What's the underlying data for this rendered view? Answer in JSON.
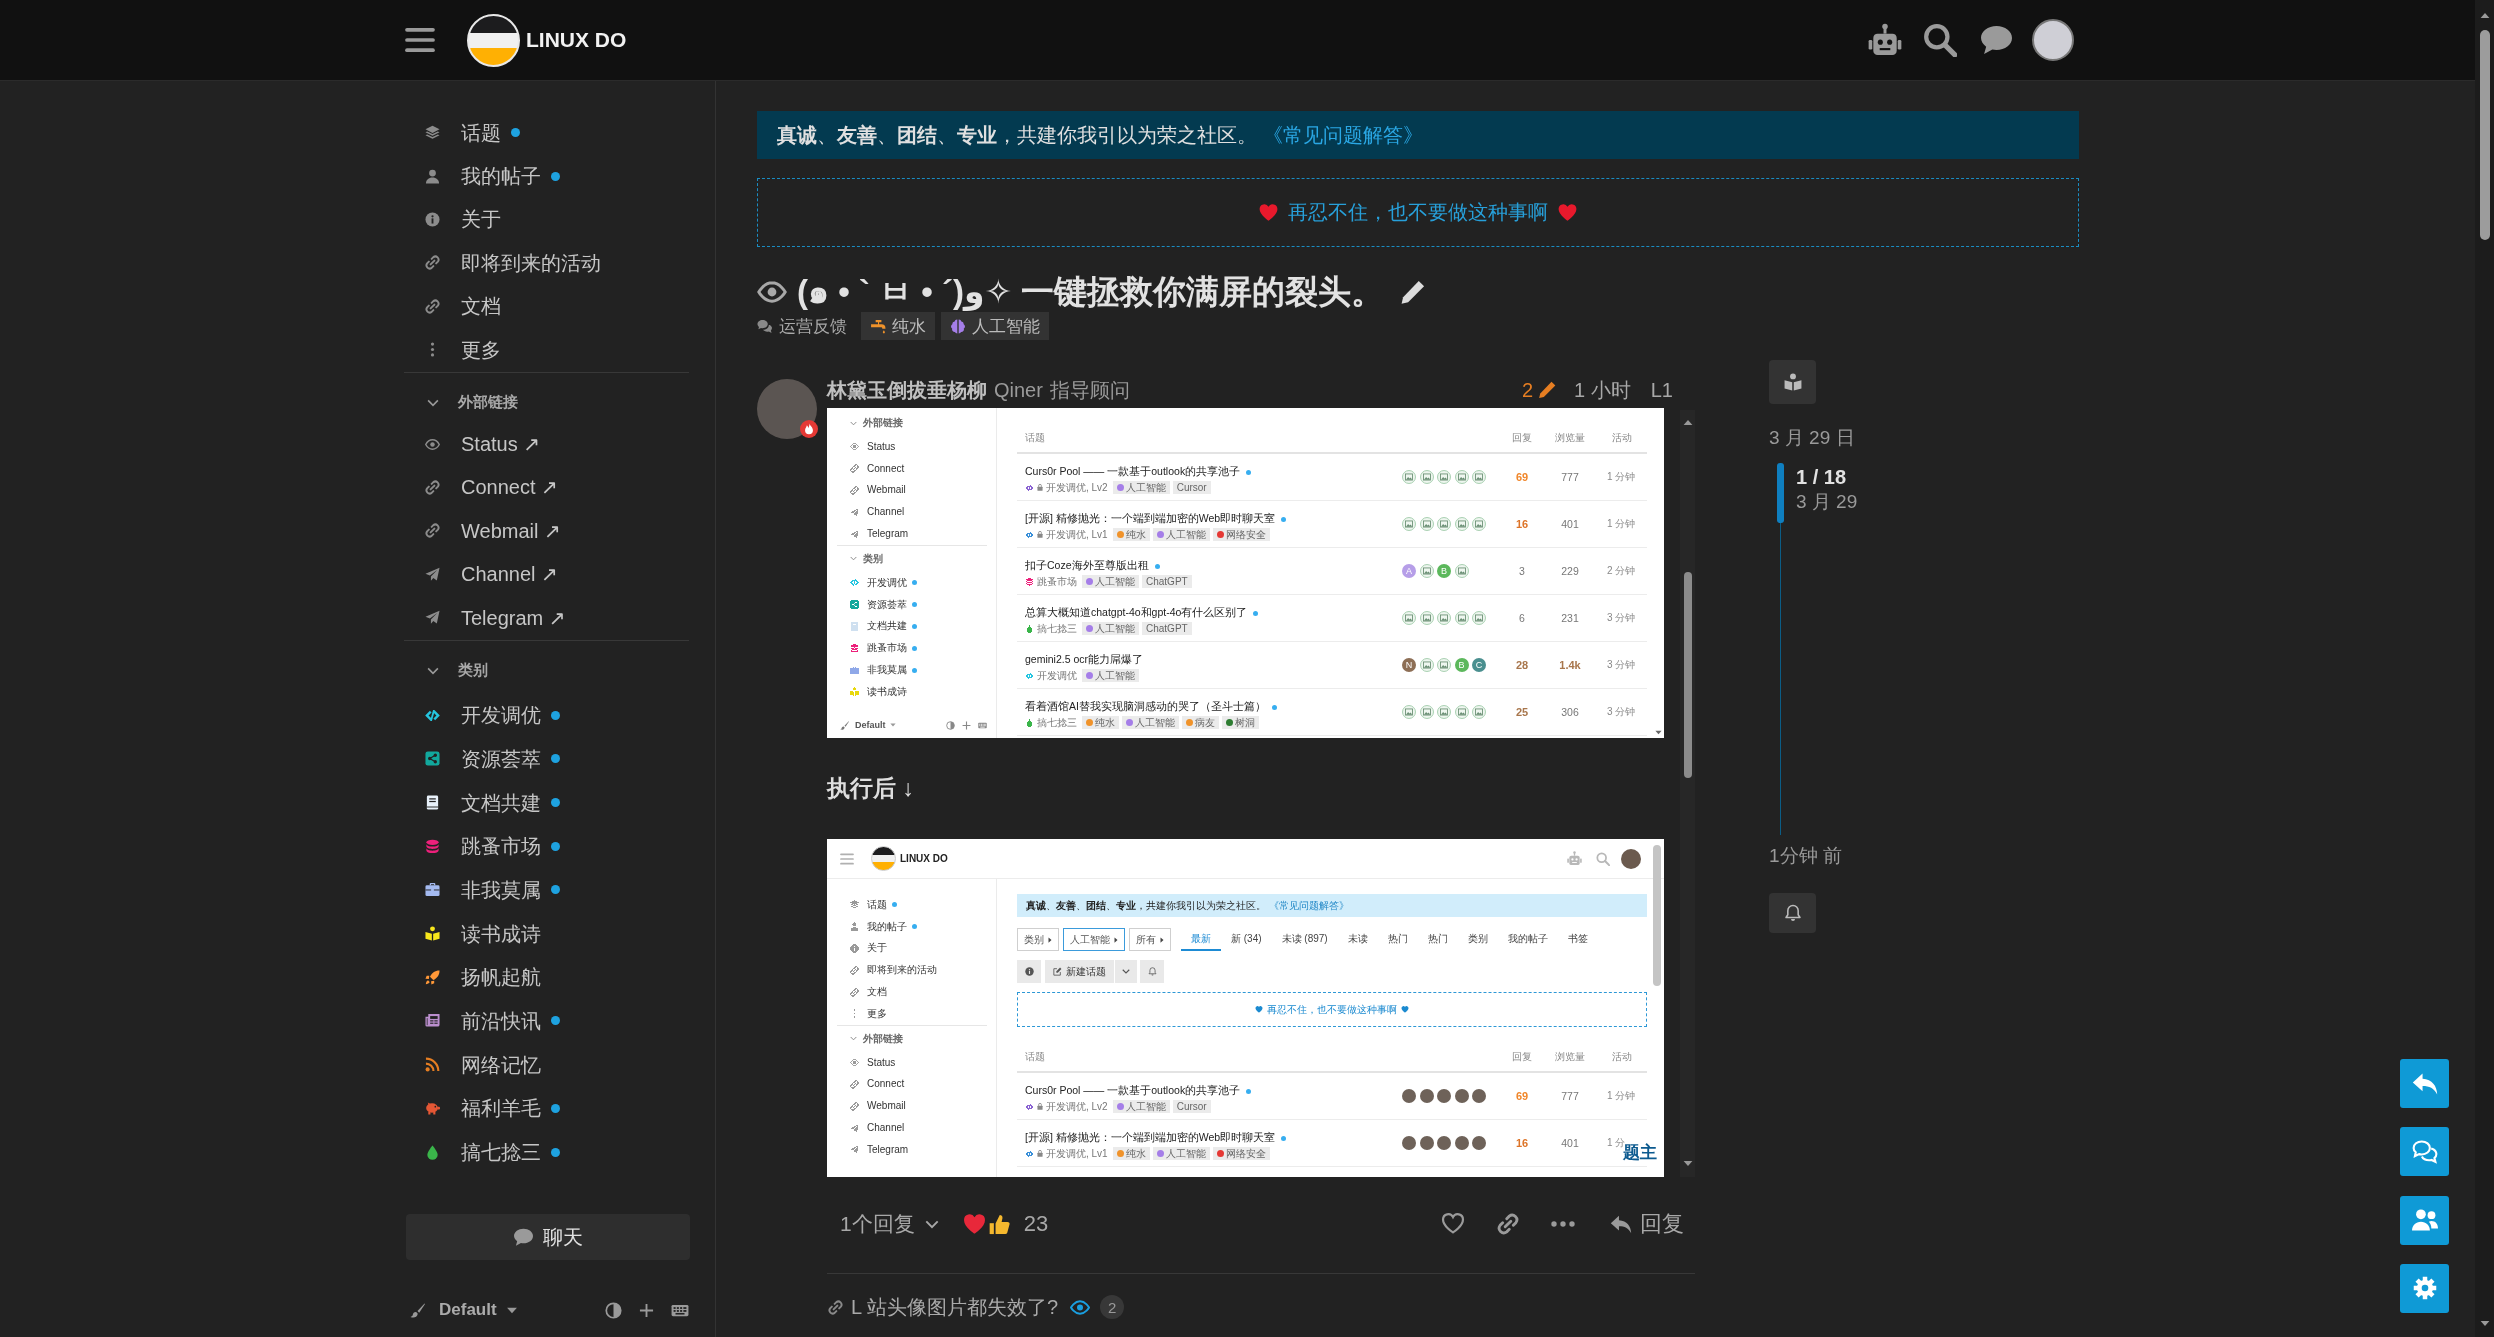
{
  "header": {
    "logo_text": "LINUX DO"
  },
  "sidebar": {
    "items": [
      {
        "label": "话题",
        "unread": true
      },
      {
        "label": "我的帖子",
        "unread": true
      },
      {
        "label": "关于",
        "unread": false
      },
      {
        "label": "即将到来的活动",
        "unread": false
      },
      {
        "label": "文档",
        "unread": false
      },
      {
        "label": "更多",
        "unread": false
      }
    ],
    "sections": [
      {
        "title": "外部链接",
        "expanded": true,
        "items": [
          {
            "label": "Status",
            "arrow": "↗"
          },
          {
            "label": "Connect",
            "arrow": "↗"
          },
          {
            "label": "Webmail",
            "arrow": "↗"
          },
          {
            "label": "Channel",
            "arrow": "↗"
          },
          {
            "label": "Telegram",
            "arrow": "↗"
          }
        ]
      },
      {
        "title": "类别",
        "expanded": true,
        "items": [
          {
            "label": "开发调优",
            "color": "#25c5e0",
            "unread": true
          },
          {
            "label": "资源荟萃",
            "color": "#12a89d",
            "unread": true
          },
          {
            "label": "文档共建",
            "color": "#e8f1fa",
            "unread": true
          },
          {
            "label": "跳蚤市场",
            "color": "#ed207b",
            "unread": true
          },
          {
            "label": "非我莫属",
            "color": "#a4baf0",
            "unread": true
          },
          {
            "label": "读书成诗",
            "color": "#f8e71c",
            "unread": false
          },
          {
            "label": "扬帆起航",
            "color": "#ff9838",
            "unread": false
          },
          {
            "label": "前沿快讯",
            "color": "#bb8fce",
            "unread": true
          },
          {
            "label": "网络记忆",
            "color": "#e67e22",
            "unread": false
          },
          {
            "label": "福利羊毛",
            "color": "#e45735",
            "unread": true
          },
          {
            "label": "搞七捻三",
            "color": "#3ab54a",
            "unread": true
          }
        ]
      }
    ],
    "chat_button": "聊天",
    "footer": {
      "theme": "Default"
    }
  },
  "banner": {
    "text": "**真诚**、**友善**、**团结**、**专业**，共建你我引以为荣之社区。",
    "link": "《常见问题解答》"
  },
  "notice": {
    "text": "再忍不住，也不要做这种事啊"
  },
  "topic": {
    "title": "(๑ • ` ㅂ • ´)و✧ 一键拯救你满屏的裂头。",
    "category": "运营反馈",
    "tags": [
      {
        "label": "纯水",
        "color": "#f0932b"
      },
      {
        "label": "人工智能",
        "color": "#a57ee8"
      }
    ]
  },
  "post": {
    "username": "林黛玉倒拔垂杨柳",
    "name": "Qiner",
    "user_title": "指导顾问",
    "edit_count": "2",
    "age": "1 小时",
    "number": "L1",
    "content": [
      {
        "kind": "screenshot",
        "sidebar": {
          "sections": [
            {
              "title": "外部链接",
              "expanded": true,
              "items": [
                {
                  "label": "Status"
                },
                {
                  "label": "Connect"
                },
                {
                  "label": "Webmail"
                },
                {
                  "label": "Channel"
                },
                {
                  "label": "Telegram"
                }
              ]
            },
            {
              "title": "类别",
              "expanded": true,
              "items": [
                {
                  "label": "开发调优",
                  "color": "#25c5e0",
                  "unread": true
                },
                {
                  "label": "资源荟萃",
                  "color": "#12a89d",
                  "unread": true
                },
                {
                  "label": "文档共建",
                  "color": "#cfe0f0",
                  "unread": true
                },
                {
                  "label": "跳蚤市场",
                  "color": "#ed207b",
                  "unread": true
                },
                {
                  "label": "非我莫属",
                  "color": "#8fa8e8",
                  "unread": true
                },
                {
                  "label": "读书成诗",
                  "color": "#e8d80c",
                  "unread": false
                }
              ]
            }
          ],
          "footer": {
            "theme": "Default"
          }
        },
        "columns": [
          "话题",
          "回复",
          "浏览量",
          "活动"
        ],
        "rows": [
          {
            "title": "Curs0r Pool —— 一款基于outlook的共享池子",
            "unread": true,
            "category": {
              "label": "开发调优, Lv2",
              "color": "#8a63d2"
            },
            "locked": true,
            "tags": [
              {
                "label": "人工智能",
                "color": "#a57ee8"
              },
              {
                "label": "Cursor"
              }
            ],
            "posters": [
              {
                "kind": "image"
              },
              {
                "kind": "image"
              },
              {
                "kind": "image"
              },
              {
                "kind": "image"
              },
              {
                "kind": "image"
              }
            ],
            "replies": {
              "text": "69",
              "color": "#f0862a"
            },
            "views": {
              "text": "777"
            },
            "activity": "1 分钟"
          },
          {
            "title": "[开源] 精修抛光：一个端到端加密的Web即时聊天室",
            "unread": true,
            "category": {
              "label": "开发调优, Lv1",
              "color": "#3a8fd8"
            },
            "locked": true,
            "tags": [
              {
                "label": "纯水",
                "color": "#f0932b"
              },
              {
                "label": "人工智能",
                "color": "#a57ee8"
              },
              {
                "label": "网络安全",
                "color": "#e53935"
              }
            ],
            "posters": [
              {
                "kind": "image"
              },
              {
                "kind": "image"
              },
              {
                "kind": "image"
              },
              {
                "kind": "image"
              },
              {
                "kind": "image"
              }
            ],
            "replies": {
              "text": "16",
              "color": "#dd7428"
            },
            "views": {
              "text": "401"
            },
            "activity": "1 分钟"
          },
          {
            "title": "扣子Coze海外至尊版出租",
            "unread": true,
            "category": {
              "label": "跳蚤市场",
              "color": "#ed207b"
            },
            "locked": false,
            "tags": [
              {
                "label": "人工智能",
                "color": "#a57ee8"
              },
              {
                "label": "ChatGPT"
              }
            ],
            "posters": [
              {
                "kind": "letter",
                "letter": "A",
                "color": "#b69ee8"
              },
              {
                "kind": "image"
              },
              {
                "kind": "letter",
                "letter": "B",
                "color": "#5cb85c"
              },
              {
                "kind": "image"
              }
            ],
            "replies": {
              "text": "3"
            },
            "views": {
              "text": "229"
            },
            "activity": "2 分钟"
          },
          {
            "title": "总算大概知道chatgpt-4o和gpt-4o有什么区别了",
            "unread": true,
            "category": {
              "label": "搞七捻三",
              "color": "#3ab54a"
            },
            "locked": false,
            "tags": [
              {
                "label": "人工智能",
                "color": "#a57ee8"
              },
              {
                "label": "ChatGPT"
              }
            ],
            "posters": [
              {
                "kind": "image"
              },
              {
                "kind": "image"
              },
              {
                "kind": "image"
              },
              {
                "kind": "image"
              },
              {
                "kind": "image"
              }
            ],
            "replies": {
              "text": "6"
            },
            "views": {
              "text": "231"
            },
            "activity": "3 分钟"
          },
          {
            "title": "gemini2.5 ocr能力屌爆了",
            "unread": false,
            "category": {
              "label": "开发调优",
              "color": "#25c5e0"
            },
            "locked": false,
            "tags": [
              {
                "label": "人工智能",
                "color": "#a57ee8"
              }
            ],
            "posters": [
              {
                "kind": "letter",
                "letter": "N",
                "color": "#8d6e55"
              },
              {
                "kind": "image"
              },
              {
                "kind": "image"
              },
              {
                "kind": "letter",
                "letter": "B",
                "color": "#5cb85c"
              },
              {
                "kind": "letter",
                "letter": "C",
                "color": "#4a8f8f"
              }
            ],
            "replies": {
              "text": "28",
              "color": "#a8764c"
            },
            "views": {
              "text": "1.4k",
              "color": "#a8764c"
            },
            "activity": "3 分钟"
          },
          {
            "title": "看着酒馆AI替我实现脑洞感动的哭了（圣斗士篇）",
            "unread": true,
            "category": {
              "label": "搞七捻三",
              "color": "#3ab54a"
            },
            "locked": false,
            "tags": [
              {
                "label": "纯水",
                "color": "#f0932b"
              },
              {
                "label": "人工智能",
                "color": "#a57ee8"
              },
              {
                "label": "病友",
                "color": "#f0932b"
              },
              {
                "label": "树洞",
                "color": "#2e7d32"
              }
            ],
            "posters": [
              {
                "kind": "image"
              },
              {
                "kind": "image"
              },
              {
                "kind": "image"
              },
              {
                "kind": "image"
              },
              {
                "kind": "image"
              }
            ],
            "replies": {
              "text": "25",
              "color": "#a8764c"
            },
            "views": {
              "text": "306"
            },
            "activity": "3 分钟"
          }
        ]
      },
      {
        "kind": "heading",
        "text": "执行后 ↓"
      },
      {
        "kind": "screenshot",
        "header": {
          "logo_text": "LINUX DO"
        },
        "sidebar": {
          "items": [
            {
              "label": "话题",
              "unread": true
            },
            {
              "label": "我的帖子",
              "unread": true
            },
            {
              "label": "关于",
              "unread": false
            },
            {
              "label": "即将到来的活动",
              "unread": false
            },
            {
              "label": "文档",
              "unread": false
            },
            {
              "label": "更多",
              "unread": false
            }
          ],
          "sections": [
            {
              "title": "外部链接",
              "expanded": true,
              "items": [
                {
                  "label": "Status"
                },
                {
                  "label": "Connect"
                },
                {
                  "label": "Webmail"
                },
                {
                  "label": "Channel"
                },
                {
                  "label": "Telegram"
                }
              ]
            }
          ]
        },
        "banner": {
          "text": "**真诚**、**友善**、**团结**、**专业**，共建你我引以为荣之社区。",
          "link": "《常见问题解答》"
        },
        "filters": [
          {
            "label": "类别",
            "active": false
          },
          {
            "label": "人工智能",
            "active": true
          },
          {
            "label": "所有",
            "active": false
          }
        ],
        "nav": [
          {
            "label": "最新",
            "selected": true
          },
          {
            "label": "新 (34)",
            "selected": false
          },
          {
            "label": "未读 (897)",
            "selected": false
          },
          {
            "label": "未读",
            "selected": false
          },
          {
            "label": "热门",
            "selected": false
          },
          {
            "label": "热门",
            "selected": false
          },
          {
            "label": "类别",
            "selected": false
          },
          {
            "label": "我的帖子",
            "selected": false
          },
          {
            "label": "书签",
            "selected": false
          }
        ],
        "new_topic_button": "新建话题",
        "notice": {
          "text": "再忍不住，也不要做这种事啊"
        },
        "columns": [
          "话题",
          "回复",
          "浏览量",
          "活动"
        ],
        "rows": [
          {
            "title": "Curs0r Pool —— 一款基于outlook的共享池子",
            "unread": true,
            "category": {
              "label": "开发调优, Lv2",
              "color": "#8a63d2"
            },
            "locked": true,
            "tags": [
              {
                "label": "人工智能",
                "color": "#a57ee8"
              },
              {
                "label": "Cursor"
              }
            ],
            "posters": [
              {
                "kind": "photo"
              },
              {
                "kind": "photo"
              },
              {
                "kind": "photo"
              },
              {
                "kind": "photo"
              },
              {
                "kind": "photo"
              }
            ],
            "replies": {
              "text": "69",
              "color": "#f0862a"
            },
            "views": {
              "text": "777"
            },
            "activity": "1 分钟"
          },
          {
            "title": "[开源] 精修抛光：一个端到端加密的Web即时聊天室",
            "unread": true,
            "category": {
              "label": "开发调优, Lv1",
              "color": "#3a8fd8"
            },
            "locked": true,
            "tags": [
              {
                "label": "纯水",
                "color": "#f0932b"
              },
              {
                "label": "人工智能",
                "color": "#a57ee8"
              },
              {
                "label": "网络安全",
                "color": "#e53935"
              }
            ],
            "posters": [
              {
                "kind": "photo"
              },
              {
                "kind": "photo"
              },
              {
                "kind": "photo"
              },
              {
                "kind": "photo"
              },
              {
                "kind": "photo"
              }
            ],
            "replies": {
              "text": "16",
              "color": "#dd7428"
            },
            "views": {
              "text": "401"
            },
            "activity": "1 分"
          }
        ],
        "label": "题主"
      }
    ],
    "replies_button": "1个回复",
    "reaction_count": "23",
    "reply_button": "回复"
  },
  "linked_topic": {
    "title": "L 站头像图片都失效了?",
    "clicks": "2"
  },
  "timeline": {
    "start_date": "3 月 29 日",
    "position": "1 / 18",
    "position_date": "3 月 29",
    "end_date": "1分钟 前"
  }
}
